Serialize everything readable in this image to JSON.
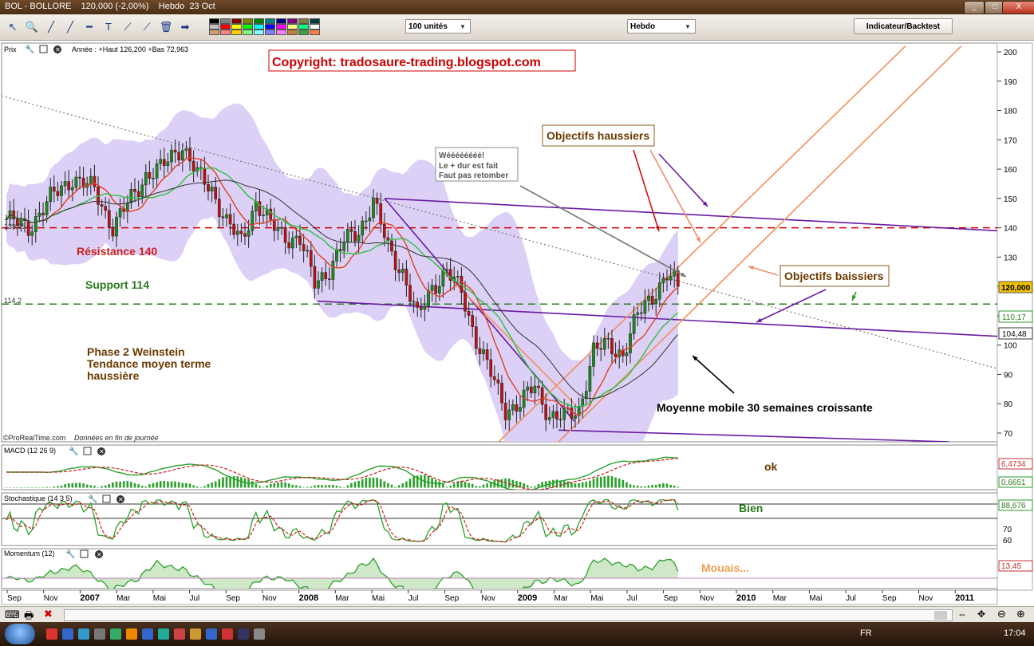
{
  "window": {
    "title": "BOL - BOLLORE    120,000 (-2,00%)    Hebdo  23 Oct",
    "min_label": "_",
    "max_label": "□",
    "close_label": "X"
  },
  "toolbar": {
    "units_select": "100 unités",
    "period_select": "Hebdo",
    "indicator_button": "Indicateur/Backtest",
    "tools": [
      "pointer-icon",
      "zoom-icon",
      "line-icon",
      "ray-icon",
      "hline-icon",
      "text-icon",
      "channel-icon",
      "fan-icon",
      "trash-icon",
      "arrow-icon"
    ],
    "tool_glyphs": [
      "↖",
      "🔍",
      "╱",
      "╱",
      "━",
      "T",
      "⟋",
      "⟋",
      "🗑",
      "➡"
    ],
    "swatch_colors": [
      "#000000",
      "#7f7f7f",
      "#7f0000",
      "#7f7f00",
      "#007f00",
      "#007f7f",
      "#00007f",
      "#7f007f",
      "#7f7f3f",
      "#003f3f",
      "#c0c0c0",
      "#ff0000",
      "#ffff00",
      "#00ff00",
      "#00ffff",
      "#0000ff",
      "#ff00ff",
      "#ffff80",
      "#00ff80",
      "#ffffff",
      "#d2a070",
      "#ff8080",
      "#ffcc00",
      "#80ff80",
      "#80ffff",
      "#8080ff",
      "#ff80ff",
      "#c08040",
      "#40a040",
      "#ff8040"
    ]
  },
  "price_panel": {
    "label": "Prix",
    "year_info": "Année : +Haut 126,200 +Bas 72,963",
    "copyright": "Copyright: tradosaure-trading.blogspot.com",
    "source": "©ProRealTime.com",
    "source_note": "Données en fin de journée",
    "resistance_tag": "139.95",
    "support_tag": "114.2",
    "price_tags": {
      "last": "120,000",
      "ma_short": "110,17",
      "ma_long": "104,48"
    },
    "annotations": {
      "resistance": "Résistance 140",
      "support": "Support 114",
      "phase1": "Phase 2 Weinstein",
      "phase2": "Tendance moyen terme",
      "phase3": "haussière",
      "ma_note": "Moyenne mobile 30 semaines croissante",
      "bull_targets": "Objectifs haussiers",
      "bear_targets": "Objectifs baissiers",
      "note1": "Wéééééééé!",
      "note2": "Le + dur est fait",
      "note3": "Faut pas retomber"
    }
  },
  "indicators": {
    "macd": {
      "label": "MACD (12 26 9)",
      "value1": "6,4734",
      "value2": "0,6651",
      "comment": "ok"
    },
    "stoch": {
      "label": "Stochastique (14 3 5)",
      "value1": "88,676",
      "comment": "Bien",
      "ticks": [
        "70",
        "60"
      ]
    },
    "momentum": {
      "label": "Momentum (12)",
      "value1": "13,45",
      "comment": "Mouais..."
    }
  },
  "colors": {
    "resistance": "#cc0000",
    "support": "#2a7a1e",
    "bollinger": "#d6c8f4",
    "ma_fast": "#e04020",
    "ma_mid": "#30c040",
    "ma_slow": "#303030",
    "trend_purple": "#6a1aa0",
    "channel_orange": "#f0905a",
    "up_candle": "#1a8a1a",
    "down_candle": "#c01010",
    "annot_brown": "#6a3a00"
  },
  "chart_data": {
    "type": "candlestick",
    "interval": "weekly",
    "x_ticks": [
      "Sep",
      "Nov",
      "2007",
      "Mar",
      "Mai",
      "Jul",
      "Sep",
      "Nov",
      "2008",
      "Mar",
      "Mai",
      "Jul",
      "Sep",
      "Nov",
      "2009",
      "Mar",
      "Mai",
      "Jul",
      "Sep",
      "Nov",
      "2010",
      "Mar",
      "Mai",
      "Jul",
      "Sep",
      "Nov",
      "2011"
    ],
    "y_ticks": [
      70,
      80,
      90,
      100,
      110,
      120,
      130,
      140,
      150,
      160,
      170,
      180,
      190,
      200
    ],
    "ylim": [
      67,
      203
    ],
    "close_anchors": [
      [
        0,
        143
      ],
      [
        6,
        140
      ],
      [
        12,
        150
      ],
      [
        18,
        157
      ],
      [
        24,
        153
      ],
      [
        29,
        140
      ],
      [
        34,
        150
      ],
      [
        38,
        158
      ],
      [
        42,
        160
      ],
      [
        46,
        166
      ],
      [
        48,
        168
      ],
      [
        52,
        158
      ],
      [
        56,
        153
      ],
      [
        60,
        142
      ],
      [
        64,
        135
      ],
      [
        68,
        149
      ],
      [
        72,
        141
      ],
      [
        76,
        137
      ],
      [
        80,
        136
      ],
      [
        84,
        121
      ],
      [
        88,
        126
      ],
      [
        92,
        135
      ],
      [
        96,
        139
      ],
      [
        100,
        149
      ],
      [
        104,
        133
      ],
      [
        108,
        125
      ],
      [
        112,
        109
      ],
      [
        116,
        120
      ],
      [
        120,
        125
      ],
      [
        124,
        118
      ],
      [
        128,
        102
      ],
      [
        132,
        90
      ],
      [
        136,
        78
      ],
      [
        140,
        80
      ],
      [
        144,
        86
      ],
      [
        148,
        76
      ],
      [
        152,
        75
      ],
      [
        156,
        78
      ],
      [
        160,
        98
      ],
      [
        164,
        100
      ],
      [
        168,
        97
      ],
      [
        172,
        110
      ],
      [
        176,
        117
      ],
      [
        180,
        124
      ],
      [
        183,
        120
      ]
    ],
    "levels": {
      "resistance": 140,
      "support": 114
    },
    "last_close": 120.0,
    "series": [
      {
        "name": "Moyenne mobile 30 semaines croissante",
        "kind": "moving_average"
      }
    ]
  }
}
